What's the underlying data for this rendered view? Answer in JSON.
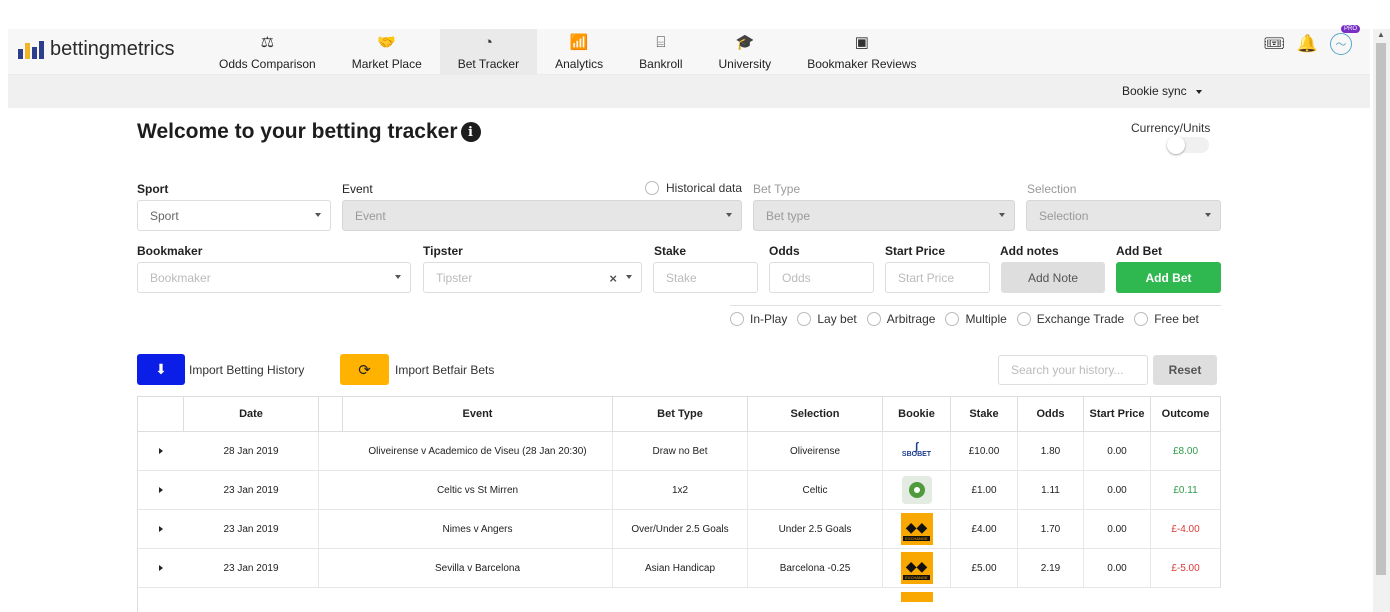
{
  "brand": {
    "name": "bettingmetrics"
  },
  "nav": [
    {
      "label": "Odds Comparison",
      "icon": "⚖"
    },
    {
      "label": "Market Place",
      "icon": "🤝"
    },
    {
      "label": "Bet Tracker",
      "icon": "◔"
    },
    {
      "label": "Analytics",
      "icon": "📶"
    },
    {
      "label": "Bankroll",
      "icon": "⌸"
    },
    {
      "label": "University",
      "icon": "🎓"
    },
    {
      "label": "Bookmaker Reviews",
      "icon": "▣"
    }
  ],
  "nav_active": "Bet Tracker",
  "header_icons": {
    "tickets": "🎟",
    "bell": "🔔",
    "avatar": "〜",
    "pro_badge": "PRO"
  },
  "subbar": {
    "bookie_sync": "Bookie sync"
  },
  "page": {
    "title": "Welcome to your betting tracker",
    "info": "i",
    "currency_label": "Currency/Units"
  },
  "form": {
    "sport_label": "Sport",
    "sport_value": "Sport",
    "event_label": "Event",
    "event_value": "Event",
    "historical_label": "Historical data",
    "bettype_label": "Bet Type",
    "bettype_value": "Bet type",
    "selection_label": "Selection",
    "selection_value": "Selection",
    "bookmaker_label": "Bookmaker",
    "bookmaker_placeholder": "Bookmaker",
    "tipster_label": "Tipster",
    "tipster_placeholder": "Tipster",
    "stake_label": "Stake",
    "stake_placeholder": "Stake",
    "odds_label": "Odds",
    "odds_placeholder": "Odds",
    "startprice_label": "Start Price",
    "startprice_placeholder": "Start Price",
    "addnotes_label": "Add notes",
    "addnote_button": "Add Note",
    "addbet_label": "Add Bet",
    "addbet_button": "Add Bet",
    "options": [
      "In-Play",
      "Lay bet",
      "Arbitrage",
      "Multiple",
      "Exchange Trade",
      "Free bet"
    ]
  },
  "actions": {
    "import_history": "Import Betting History",
    "import_betfair": "Import Betfair Bets",
    "search_placeholder": "Search your history...",
    "reset": "Reset"
  },
  "table": {
    "headers": [
      "Date",
      "Event",
      "Bet Type",
      "Selection",
      "Bookie",
      "Stake",
      "Odds",
      "Start Price",
      "Outcome"
    ],
    "rows": [
      {
        "date": "28 Jan 2019",
        "event": "Oliveirense v Academico de Viseu (28 Jan 20:30)",
        "bettype": "Draw no Bet",
        "selection": "Oliveirense",
        "bookie": "SBOBET",
        "stake": "£10.00",
        "odds": "1.80",
        "start": "0.00",
        "outcome": "£8.00",
        "positive": true
      },
      {
        "date": "23 Jan 2019",
        "event": "Celtic vs St Mirren",
        "bettype": "1x2",
        "selection": "Celtic",
        "bookie": "green",
        "stake": "£1.00",
        "odds": "1.11",
        "start": "0.00",
        "outcome": "£0.11",
        "positive": true
      },
      {
        "date": "23 Jan 2019",
        "event": "Nimes v Angers",
        "bettype": "Over/Under 2.5 Goals",
        "selection": "Under 2.5 Goals",
        "bookie": "EXCHANGE",
        "stake": "£4.00",
        "odds": "1.70",
        "start": "0.00",
        "outcome": "£-4.00",
        "positive": false
      },
      {
        "date": "23 Jan 2019",
        "event": "Sevilla v Barcelona",
        "bettype": "Asian Handicap",
        "selection": "Barcelona -0.25",
        "bookie": "EXCHANGE",
        "stake": "£5.00",
        "odds": "2.19",
        "start": "0.00",
        "outcome": "£-5.00",
        "positive": false
      }
    ]
  },
  "colors": {
    "addbet": "#2fb84f",
    "import_history": "#0a1ee8",
    "import_betfair": "#ffb300"
  }
}
